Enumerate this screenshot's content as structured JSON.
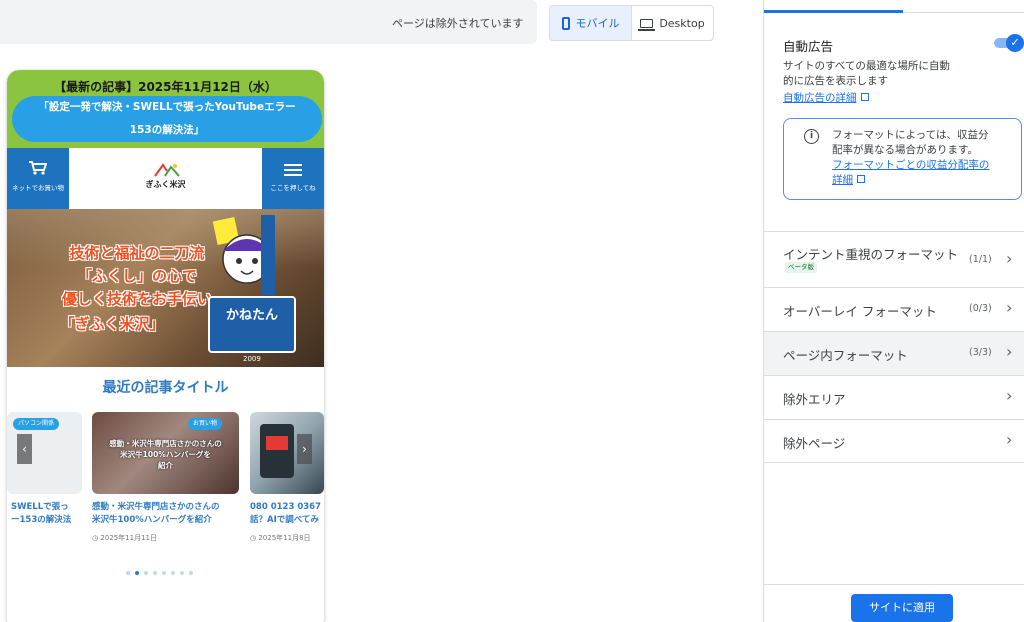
{
  "topbar": {
    "excluded_text": "ページは除外されています",
    "device_mobile_label": "モバイル",
    "device_desktop_label": "Desktop",
    "active_device": "mobile"
  },
  "preview": {
    "notice_title": "【最新の記事】2025年11月12日（水）",
    "notice_line1": "「設定一発で解決・SWELLで張ったYouTubeエラー",
    "notice_line2": "153の解決法」",
    "header": {
      "cart_label": "ネットでお買い物",
      "logo_text": "ぎふく米沢",
      "menu_label": "ここを押してね"
    },
    "hero": {
      "line1": "技術と福祉の二刀流",
      "line2": "「ふくし」の心で",
      "line3": "優しく技術をお手伝い",
      "line4": "「ぎふく米沢」",
      "badge_name": "かねたん",
      "year": "2009"
    },
    "recent_title": "最近の記事タイトル",
    "cards": [
      {
        "tag": "パソコン関係",
        "overlay_line1": "",
        "overlay_line2": "",
        "title_line1": "SWELLで張っ",
        "title_line2": "ー153の解決法",
        "date": ""
      },
      {
        "tag": "お買い物",
        "overlay_line1": "感動・米沢牛専門店さかのさんの",
        "overlay_line2": "米沢牛100%ハンバーグを",
        "overlay_line3": "紹介",
        "title_line1": "感動・米沢牛専門店さかのさんの",
        "title_line2": "米沢牛100%ハンバーグを紹介",
        "date": "2025年11月11日"
      },
      {
        "tag": "",
        "title_line1": "080 0123 0367",
        "title_line2": "話？AIで調べてみ",
        "date": "2025年11月8日"
      }
    ],
    "carousel_prev": "‹",
    "carousel_next": "›",
    "dot_count": 8,
    "active_dot": 1
  },
  "panel": {
    "auto_ads_title": "自動広告",
    "auto_ads_enabled": true,
    "auto_ads_desc_line1": "サイトのすべての最適な場所に自動",
    "auto_ads_desc_line2": "的に広告を表示します",
    "auto_ads_link": "自動広告の詳細",
    "info_line1": "フォーマットによっては、収益分",
    "info_line2": "配率が異なる場合があります。",
    "info_link_line1": "フォーマットごとの収益分配率の",
    "info_link_line2": "詳細",
    "rows": [
      {
        "label": "インテント重視のフォーマット",
        "count": "(1/1)",
        "badge": "ベータ版"
      },
      {
        "label": "オーバーレイ フォーマット",
        "count": "(0/3)"
      },
      {
        "label": "ページ内フォーマット",
        "count": "(3/3)"
      },
      {
        "label": "除外エリア",
        "count": ""
      },
      {
        "label": "除外ページ",
        "count": ""
      }
    ],
    "apply_label": "サイトに適用"
  },
  "colors": {
    "accent": "#1a73e8",
    "notice_green": "#8bc53f",
    "site_blue": "#1e73be",
    "link_blue": "#2e7ac4"
  }
}
